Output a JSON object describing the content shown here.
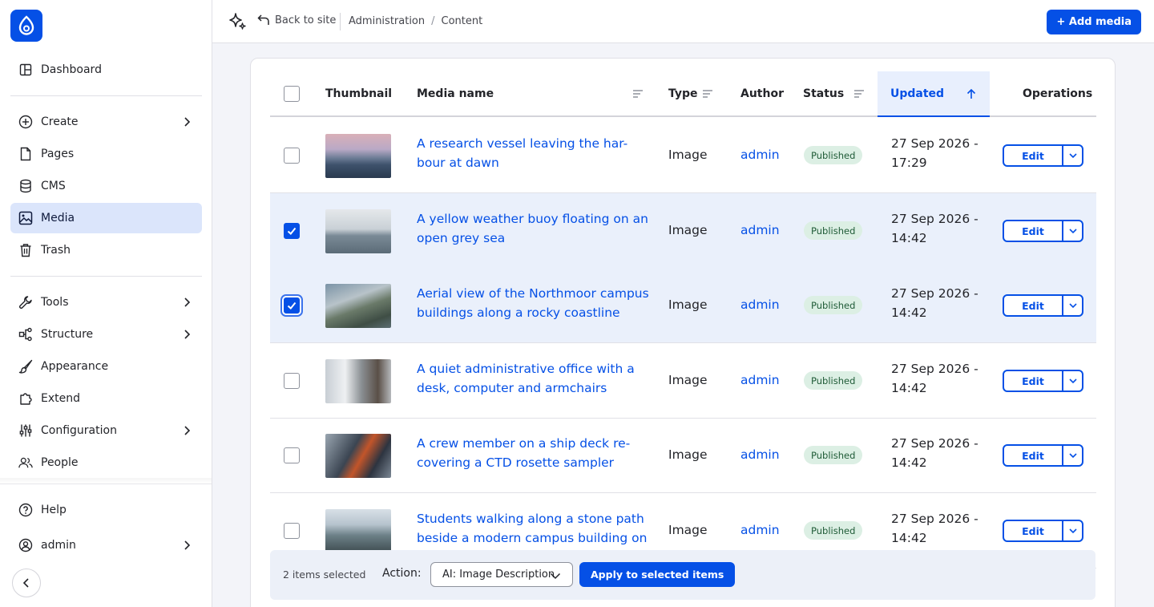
{
  "sidebar": {
    "items": [
      {
        "label": "Dashboard"
      },
      {
        "label": "Create"
      },
      {
        "label": "Pages"
      },
      {
        "label": "CMS"
      },
      {
        "label": "Media"
      },
      {
        "label": "Trash"
      },
      {
        "label": "Tools"
      },
      {
        "label": "Structure"
      },
      {
        "label": "Appearance"
      },
      {
        "label": "Extend"
      },
      {
        "label": "Configuration"
      },
      {
        "label": "People"
      }
    ],
    "help": "Help",
    "user": "admin"
  },
  "topbar": {
    "back_label": "Back to site",
    "breadcrumb": [
      "Administration",
      "Content"
    ],
    "breadcrumb_sep": "/",
    "add_media_label": "+ Add media"
  },
  "table": {
    "headers": {
      "thumbnail": "Thumbnail",
      "media_name": "Media name",
      "type": "Type",
      "author": "Author",
      "status": "Status",
      "updated": "Updated",
      "operations": "Operations"
    },
    "rows": [
      {
        "name": "A research vessel leaving the har-bour at dawn",
        "type": "Image",
        "author": "admin",
        "status": "Published",
        "updated": "27 Sep 2026 - 17:29",
        "edit": "Edit"
      },
      {
        "name": "A yellow weather buoy floating on an open grey sea",
        "type": "Image",
        "author": "admin",
        "status": "Published",
        "updated": "27 Sep 2026 - 14:42",
        "edit": "Edit"
      },
      {
        "name": "Aerial view of the Northmoor campus buildings along a rocky coastline",
        "type": "Image",
        "author": "admin",
        "status": "Published",
        "updated": "27 Sep 2026 - 14:42",
        "edit": "Edit"
      },
      {
        "name": "A quiet administrative office with a desk, computer and armchairs",
        "type": "Image",
        "author": "admin",
        "status": "Published",
        "updated": "27 Sep 2026 - 14:42",
        "edit": "Edit"
      },
      {
        "name": "A crew member on a ship deck re-covering a CTD rosette sampler",
        "type": "Image",
        "author": "admin",
        "status": "Published",
        "updated": "27 Sep 2026 - 14:42",
        "edit": "Edit"
      },
      {
        "name": "Students walking along a stone path beside a modern campus building on",
        "type": "Image",
        "author": "admin",
        "status": "Published",
        "updated": "27 Sep 2026 - 14:42",
        "edit": "Edit"
      }
    ]
  },
  "bulk": {
    "count": "2 items selected",
    "action_label": "Action:",
    "selected_action": "AI: Image Description",
    "apply_label": "Apply to selected items"
  },
  "colors": {
    "accent": "#0550e6",
    "selected_row": "#eaf0fb",
    "badge_bg": "#dcefe4"
  }
}
